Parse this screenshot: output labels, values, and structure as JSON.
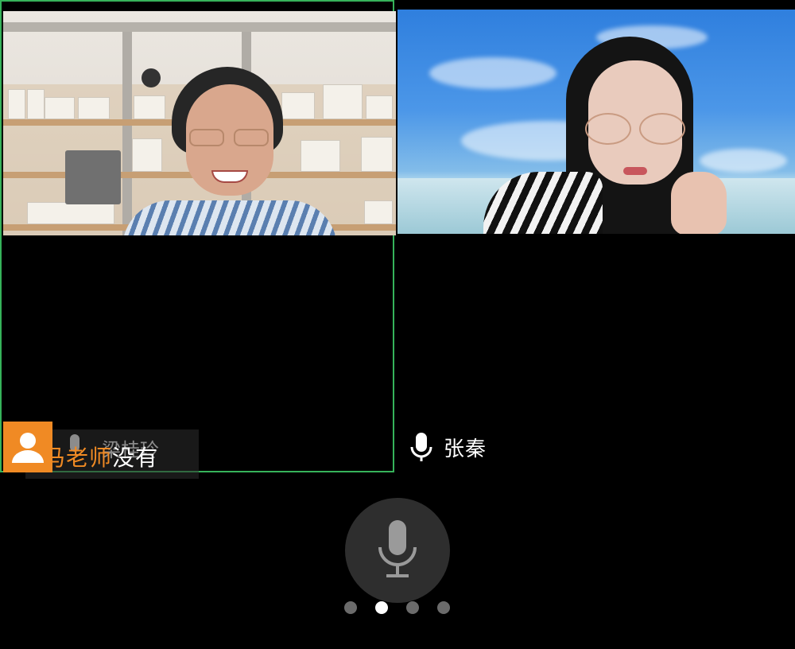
{
  "participants": [
    {
      "overlay_name_orange": "马老师",
      "overlay_name_white": "没有",
      "ghost_name": "梁桂玲",
      "active_speaker": true
    },
    {
      "name": "张秦"
    }
  ],
  "colors": {
    "active_border": "#36b35a",
    "avatar_badge": "#f08a24"
  },
  "icons": {
    "mic": "microphone-icon",
    "avatar": "person-icon"
  },
  "pager": {
    "total": 4,
    "active_index": 1
  }
}
